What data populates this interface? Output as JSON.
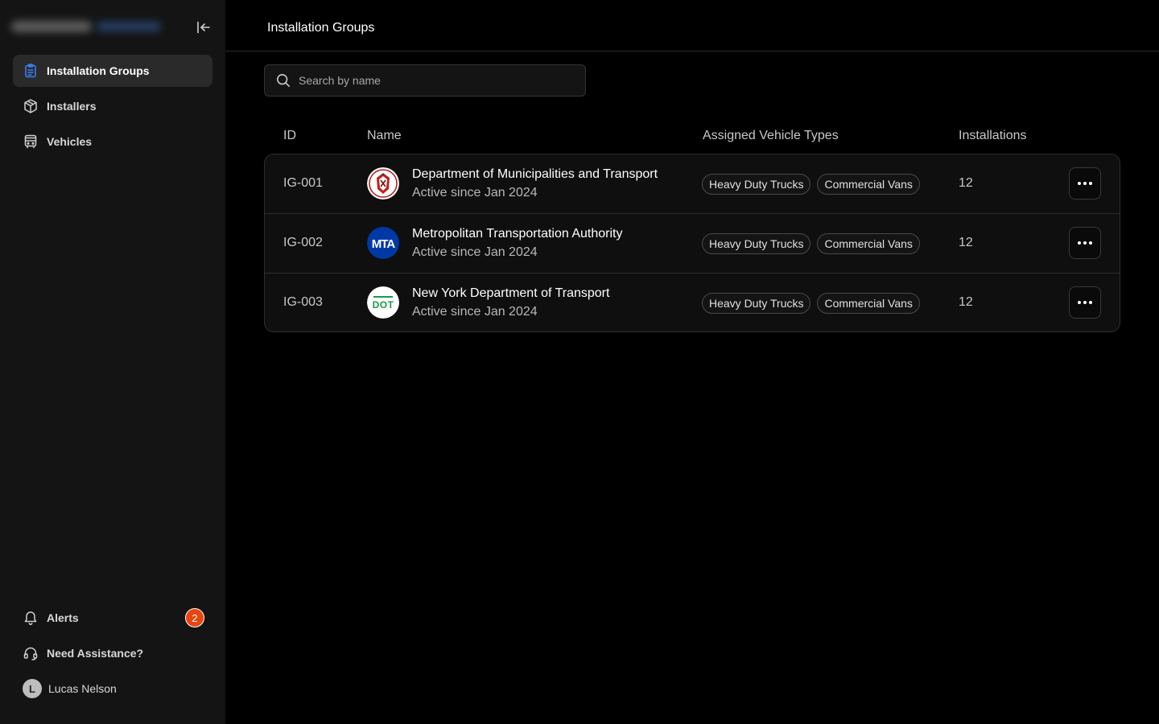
{
  "sidebar": {
    "items": [
      {
        "label": "Installation Groups",
        "icon": "clipboard-icon",
        "active": true
      },
      {
        "label": "Installers",
        "icon": "box-icon"
      },
      {
        "label": "Vehicles",
        "icon": "bus-icon"
      }
    ],
    "bottom": {
      "alerts_label": "Alerts",
      "alerts_count": "2",
      "assistance_label": "Need Assistance?",
      "user_initial": "L",
      "user_name": "Lucas Nelson"
    }
  },
  "header": {
    "title": "Installation Groups"
  },
  "search": {
    "placeholder": "Search by name",
    "value": ""
  },
  "table": {
    "columns": [
      "ID",
      "Name",
      "Assigned Vehicle Types",
      "Installations"
    ],
    "rows": [
      {
        "id": "IG-001",
        "name": "Department of Municipalities and Transport",
        "since": "Active since Jan 2024",
        "tags": [
          "Heavy Duty Trucks",
          "Commercial Vans"
        ],
        "installations": "12"
      },
      {
        "id": "IG-002",
        "name": "Metropolitan Transportation Authority",
        "since": "Active since Jan 2024",
        "tags": [
          "Heavy Duty Trucks",
          "Commercial Vans"
        ],
        "installations": "12",
        "logo_text": "MTA"
      },
      {
        "id": "IG-003",
        "name": "New York Department of Transport",
        "since": "Active since Jan 2024",
        "tags": [
          "Heavy Duty Trucks",
          "Commercial Vans"
        ],
        "installations": "12",
        "logo_text": "DOT"
      }
    ]
  },
  "colors": {
    "accent_blue": "#3b82f6",
    "badge_orange": "#e8450f",
    "mta_blue": "#0039a6",
    "dot_green": "#1a9a4b"
  }
}
